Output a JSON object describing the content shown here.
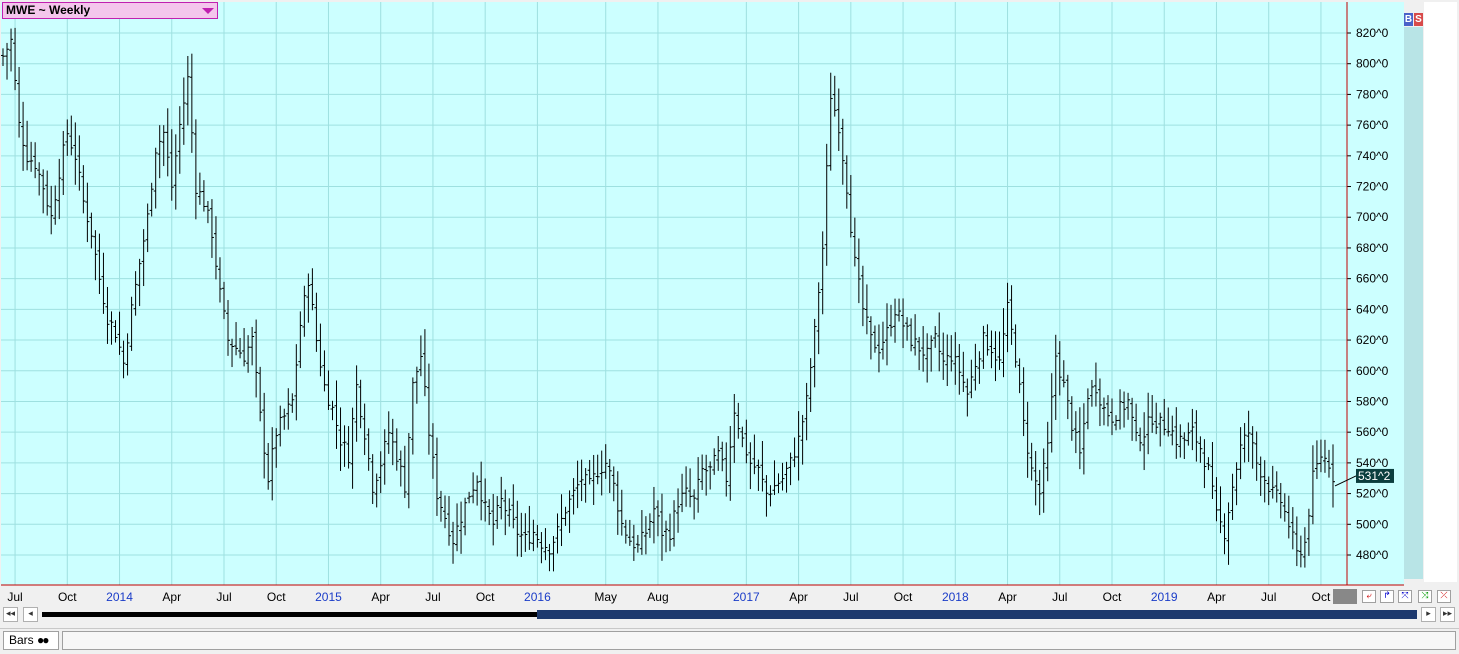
{
  "header": {
    "symbol_label": "MWE ~ Weekly",
    "b_label": "B",
    "s_label": "S"
  },
  "status": {
    "tab_label": "Bars"
  },
  "colors": {
    "background": "#ccffff",
    "grid": "#9ee0e0",
    "bars": "#000000",
    "axis": "#c00000",
    "year_labels": "#1a3cc8",
    "price_tag": "#0b3e3e"
  },
  "chart_data": {
    "type": "ohlc",
    "title": "",
    "xlabel": "",
    "ylabel": "",
    "price_unit": "cents/bushel (quarter-cent fractions)",
    "ylim": [
      464,
      830
    ],
    "y_ticks": [
      "820^0",
      "800^0",
      "780^0",
      "760^0",
      "740^0",
      "720^0",
      "700^0",
      "680^0",
      "660^0",
      "640^0",
      "620^0",
      "600^0",
      "580^0",
      "560^0",
      "540^0",
      "520^0",
      "500^0",
      "480^0"
    ],
    "y_tick_values": [
      820,
      800,
      780,
      760,
      740,
      720,
      700,
      680,
      660,
      640,
      620,
      600,
      580,
      560,
      540,
      520,
      500,
      480
    ],
    "last_price_label": "531^2",
    "last_price": 531.5,
    "x_labels": [
      {
        "text": "Jul",
        "week": 3,
        "year": false
      },
      {
        "text": "Oct",
        "week": 16,
        "year": false
      },
      {
        "text": "2014",
        "week": 29,
        "year": true
      },
      {
        "text": "Apr",
        "week": 42,
        "year": false
      },
      {
        "text": "Jul",
        "week": 55,
        "year": false
      },
      {
        "text": "Oct",
        "week": 68,
        "year": false
      },
      {
        "text": "2015",
        "week": 81,
        "year": true
      },
      {
        "text": "Apr",
        "week": 94,
        "year": false
      },
      {
        "text": "Jul",
        "week": 107,
        "year": false
      },
      {
        "text": "Oct",
        "week": 120,
        "year": false
      },
      {
        "text": "2016",
        "week": 133,
        "year": true
      },
      {
        "text": "May",
        "week": 150,
        "year": false
      },
      {
        "text": "Aug",
        "week": 163,
        "year": false
      },
      {
        "text": "2017",
        "week": 185,
        "year": true
      },
      {
        "text": "Apr",
        "week": 198,
        "year": false
      },
      {
        "text": "Jul",
        "week": 211,
        "year": false
      },
      {
        "text": "Oct",
        "week": 224,
        "year": false
      },
      {
        "text": "2018",
        "week": 237,
        "year": true
      },
      {
        "text": "Apr",
        "week": 250,
        "year": false
      },
      {
        "text": "Jul",
        "week": 263,
        "year": false
      },
      {
        "text": "Oct",
        "week": 276,
        "year": false
      },
      {
        "text": "2019",
        "week": 289,
        "year": true
      },
      {
        "text": "Apr",
        "week": 302,
        "year": false
      },
      {
        "text": "Jul",
        "week": 315,
        "year": false
      },
      {
        "text": "Oct",
        "week": 328,
        "year": false
      }
    ],
    "close_anchors": [
      [
        0,
        805
      ],
      [
        2,
        815
      ],
      [
        4,
        760
      ],
      [
        6,
        740
      ],
      [
        8,
        735
      ],
      [
        10,
        720
      ],
      [
        12,
        700
      ],
      [
        14,
        730
      ],
      [
        16,
        755
      ],
      [
        18,
        740
      ],
      [
        20,
        710
      ],
      [
        22,
        690
      ],
      [
        24,
        660
      ],
      [
        26,
        635
      ],
      [
        28,
        625
      ],
      [
        30,
        605
      ],
      [
        32,
        640
      ],
      [
        34,
        670
      ],
      [
        36,
        700
      ],
      [
        38,
        745
      ],
      [
        40,
        755
      ],
      [
        42,
        720
      ],
      [
        44,
        760
      ],
      [
        46,
        790
      ],
      [
        48,
        720
      ],
      [
        50,
        710
      ],
      [
        52,
        690
      ],
      [
        54,
        650
      ],
      [
        56,
        620
      ],
      [
        58,
        615
      ],
      [
        60,
        610
      ],
      [
        62,
        620
      ],
      [
        64,
        570
      ],
      [
        66,
        530
      ],
      [
        68,
        560
      ],
      [
        70,
        570
      ],
      [
        72,
        580
      ],
      [
        74,
        630
      ],
      [
        76,
        660
      ],
      [
        78,
        620
      ],
      [
        80,
        590
      ],
      [
        82,
        575
      ],
      [
        84,
        555
      ],
      [
        86,
        545
      ],
      [
        88,
        590
      ],
      [
        90,
        560
      ],
      [
        92,
        525
      ],
      [
        94,
        540
      ],
      [
        96,
        560
      ],
      [
        98,
        545
      ],
      [
        100,
        525
      ],
      [
        102,
        590
      ],
      [
        104,
        610
      ],
      [
        106,
        560
      ],
      [
        108,
        520
      ],
      [
        110,
        505
      ],
      [
        112,
        490
      ],
      [
        114,
        505
      ],
      [
        116,
        520
      ],
      [
        118,
        530
      ],
      [
        120,
        510
      ],
      [
        122,
        500
      ],
      [
        124,
        515
      ],
      [
        126,
        505
      ],
      [
        128,
        495
      ],
      [
        130,
        490
      ],
      [
        132,
        495
      ],
      [
        134,
        488
      ],
      [
        136,
        485
      ],
      [
        138,
        495
      ],
      [
        140,
        510
      ],
      [
        142,
        520
      ],
      [
        144,
        530
      ],
      [
        146,
        525
      ],
      [
        148,
        535
      ],
      [
        150,
        540
      ],
      [
        152,
        525
      ],
      [
        154,
        500
      ],
      [
        156,
        490
      ],
      [
        158,
        485
      ],
      [
        160,
        495
      ],
      [
        162,
        510
      ],
      [
        164,
        495
      ],
      [
        166,
        495
      ],
      [
        168,
        515
      ],
      [
        170,
        520
      ],
      [
        172,
        515
      ],
      [
        174,
        535
      ],
      [
        176,
        535
      ],
      [
        178,
        545
      ],
      [
        180,
        530
      ],
      [
        182,
        575
      ],
      [
        184,
        555
      ],
      [
        186,
        540
      ],
      [
        188,
        535
      ],
      [
        190,
        520
      ],
      [
        192,
        525
      ],
      [
        194,
        530
      ],
      [
        196,
        540
      ],
      [
        198,
        555
      ],
      [
        200,
        580
      ],
      [
        202,
        625
      ],
      [
        204,
        680
      ],
      [
        206,
        780
      ],
      [
        208,
        760
      ],
      [
        210,
        720
      ],
      [
        212,
        670
      ],
      [
        214,
        640
      ],
      [
        216,
        620
      ],
      [
        218,
        615
      ],
      [
        220,
        625
      ],
      [
        222,
        640
      ],
      [
        224,
        630
      ],
      [
        226,
        620
      ],
      [
        228,
        615
      ],
      [
        230,
        610
      ],
      [
        232,
        620
      ],
      [
        234,
        605
      ],
      [
        236,
        610
      ],
      [
        238,
        600
      ],
      [
        240,
        585
      ],
      [
        242,
        605
      ],
      [
        244,
        620
      ],
      [
        246,
        615
      ],
      [
        248,
        605
      ],
      [
        250,
        640
      ],
      [
        252,
        610
      ],
      [
        254,
        565
      ],
      [
        256,
        535
      ],
      [
        258,
        520
      ],
      [
        260,
        550
      ],
      [
        262,
        610
      ],
      [
        264,
        590
      ],
      [
        266,
        565
      ],
      [
        268,
        545
      ],
      [
        270,
        585
      ],
      [
        272,
        590
      ],
      [
        274,
        575
      ],
      [
        276,
        570
      ],
      [
        278,
        575
      ],
      [
        280,
        580
      ],
      [
        282,
        555
      ],
      [
        284,
        560
      ],
      [
        286,
        570
      ],
      [
        288,
        565
      ],
      [
        290,
        565
      ],
      [
        292,
        555
      ],
      [
        294,
        555
      ],
      [
        296,
        560
      ],
      [
        298,
        550
      ],
      [
        300,
        535
      ],
      [
        302,
        505
      ],
      [
        304,
        495
      ],
      [
        306,
        525
      ],
      [
        308,
        550
      ],
      [
        310,
        560
      ],
      [
        312,
        540
      ],
      [
        314,
        530
      ],
      [
        316,
        520
      ],
      [
        318,
        515
      ],
      [
        320,
        500
      ],
      [
        322,
        480
      ],
      [
        324,
        488
      ],
      [
        326,
        530
      ],
      [
        328,
        545
      ],
      [
        330,
        540
      ],
      [
        331,
        531.5
      ]
    ],
    "x_range_weeks": [
      0,
      331
    ]
  }
}
